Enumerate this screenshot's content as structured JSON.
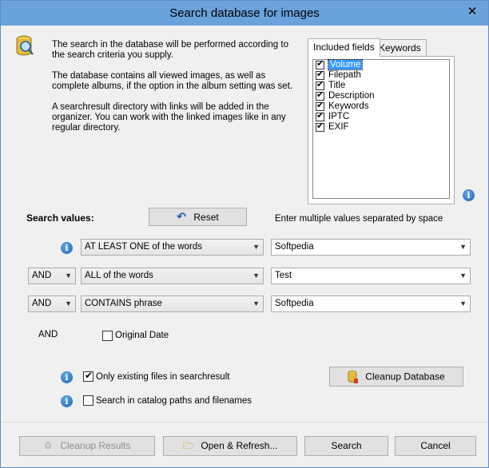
{
  "window": {
    "title": "Search database for images",
    "close_glyph": "✕"
  },
  "info": {
    "icon": "search-database-icon",
    "paragraph1": "The search in the database will be performed according to the search criteria you supply.",
    "paragraph2": "The database contains all viewed images, as well as complete albums, if the option in the album setting was set.",
    "paragraph3": "A searchresult directory with links will be added in the organizer. You can work with the linked images like in any regular directory."
  },
  "tabs": [
    {
      "label": "Included fields"
    },
    {
      "label": "Keywords"
    }
  ],
  "fields": [
    {
      "label": "Volume",
      "checked": true,
      "selected": true
    },
    {
      "label": "Filepath",
      "checked": true
    },
    {
      "label": "Title",
      "checked": true
    },
    {
      "label": "Description",
      "checked": true
    },
    {
      "label": "Keywords",
      "checked": true
    },
    {
      "label": "IPTC",
      "checked": true
    },
    {
      "label": "EXIF",
      "checked": true
    }
  ],
  "search": {
    "heading": "Search values:",
    "reset_label": "Reset",
    "hint": "Enter multiple values separated by space",
    "rows": [
      {
        "operator": "",
        "mode": "AT LEAST ONE of the words",
        "value": "Softpedia"
      },
      {
        "operator": "AND",
        "mode": "ALL of the words",
        "value": "Test"
      },
      {
        "operator": "AND",
        "mode": "CONTAINS phrase",
        "value": "Softpedia"
      }
    ],
    "date_operator": "AND",
    "original_date_label": "Original Date",
    "original_date_checked": false
  },
  "options": {
    "only_existing_label": "Only existing files in searchresult",
    "only_existing_checked": true,
    "catalog_paths_label": "Search in catalog paths and filenames",
    "catalog_paths_checked": false,
    "cleanup_db_label": "Cleanup Database"
  },
  "footer": {
    "cleanup_results_label": "Cleanup Results",
    "open_refresh_label": "Open & Refresh...",
    "search_label": "Search",
    "cancel_label": "Cancel"
  }
}
